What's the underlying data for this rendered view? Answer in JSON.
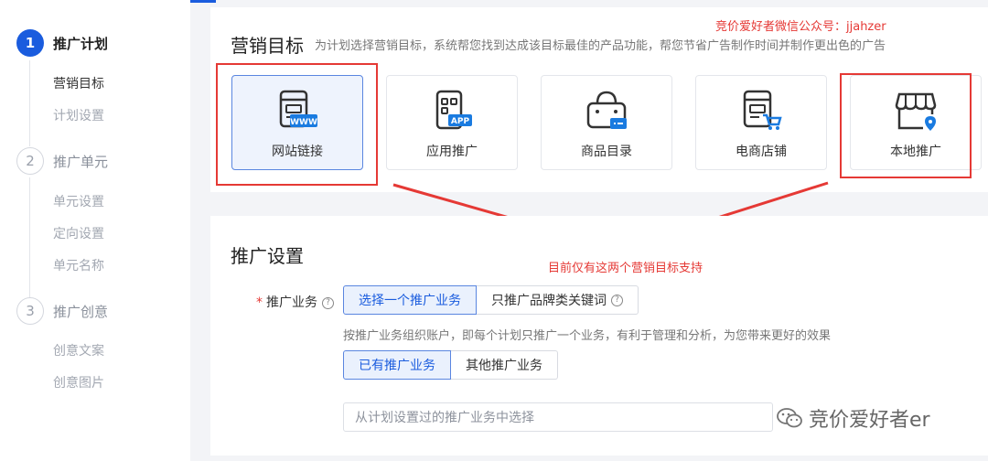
{
  "sidebar": {
    "steps": [
      {
        "num": "1",
        "label": "推广计划",
        "subs": [
          "营销目标",
          "计划设置"
        ]
      },
      {
        "num": "2",
        "label": "推广单元",
        "subs": [
          "单元设置",
          "定向设置",
          "单元名称"
        ]
      },
      {
        "num": "3",
        "label": "推广创意",
        "subs": [
          "创意文案",
          "创意图片"
        ]
      }
    ]
  },
  "goals": {
    "title": "营销目标",
    "description": "为计划选择营销目标，系统帮您找到达成该目标最佳的产品功能，帮您节省广告制作时间并制作更出色的广告",
    "cards": [
      {
        "label": "网站链接",
        "icon": "website-link-icon",
        "badge": "WWW"
      },
      {
        "label": "应用推广",
        "icon": "app-promotion-icon",
        "badge": "APP"
      },
      {
        "label": "商品目录",
        "icon": "product-catalog-icon"
      },
      {
        "label": "电商店铺",
        "icon": "ecommerce-store-icon"
      },
      {
        "label": "本地推广",
        "icon": "local-promotion-icon"
      }
    ]
  },
  "annotations": {
    "top_note": "竞价爱好者微信公众号：jjahzer",
    "arrow_note": "目前仅有这两个营销目标支持"
  },
  "promo": {
    "title": "推广设置",
    "business_label": "推广业务",
    "business_options": [
      "选择一个推广业务",
      "只推广品牌类关键词"
    ],
    "hint": "按推广业务组织账户，即每个计划只推广一个业务，有利于管理和分析，为您带来更好的效果",
    "source_options": [
      "已有推广业务",
      "其他推广业务"
    ],
    "select_placeholder": "从计划设置过的推广业务中选择"
  },
  "watermark": {
    "text": "竞价爱好者er"
  },
  "colors": {
    "primary": "#1a5cde",
    "annotation_red": "#e53935"
  }
}
